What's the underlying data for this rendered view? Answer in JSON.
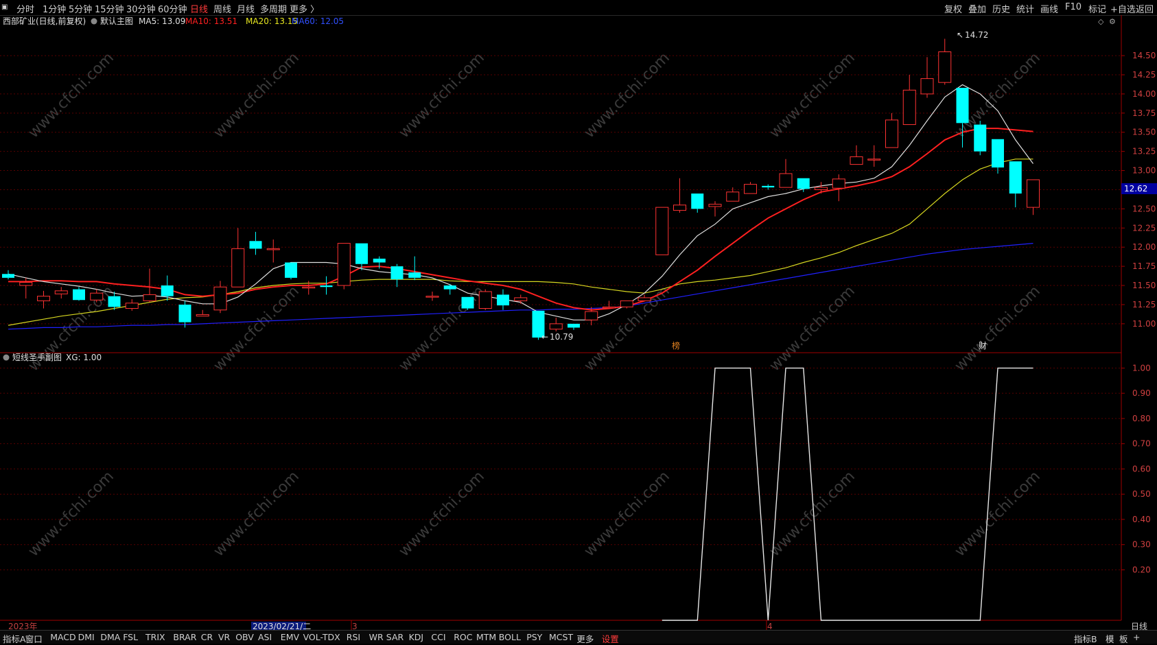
{
  "topbar": {
    "periods": [
      "分时",
      "1分钟",
      "5分钟",
      "15分钟",
      "30分钟",
      "60分钟",
      "日线",
      "周线",
      "月线",
      "多周期",
      "更多 〉"
    ],
    "active_period": "日线",
    "right_buttons": [
      "复权",
      "叠加",
      "历史",
      "统计",
      "画线",
      "F10",
      "标记",
      "+自选",
      "返回"
    ]
  },
  "main_chart": {
    "stock_name": "西部矿业(日线,前复权)",
    "indicator_name": "默认主图",
    "ma5_label": "MA5: 13.09",
    "ma10_label": "MA10: 13.51",
    "ma20_label": "MA20: 13.15",
    "ma60_label": "MA60: 12.05",
    "high_marker": "14.72",
    "low_marker": "10.79",
    "current_price": "12.62",
    "event_labels": [
      "榜",
      "财"
    ],
    "colors": {
      "up": "#ff3333",
      "down": "#00ffff",
      "ma5": "#e0e0e0",
      "ma10": "#ff2020",
      "ma20": "#d8d820",
      "ma60": "#2020ff",
      "grid": "#5a0000"
    }
  },
  "sub_chart": {
    "title": "短线圣手副图",
    "xg_label": "XG: 1.00"
  },
  "x_axis": {
    "labels": [
      "2023年",
      "2023/02/21/二",
      "3",
      "4"
    ]
  },
  "right_panel_label": "日线",
  "bottom_tabs": [
    "指标A",
    "窗口",
    "MACD",
    "DMI",
    "DMA",
    "FSL",
    "TRIX",
    "BRAR",
    "CR",
    "VR",
    "OBV",
    "ASI",
    "EMV",
    "VOL-TDX",
    "RSI",
    "WR",
    "SAR",
    "KDJ",
    "CCI",
    "ROC",
    "MTM",
    "BOLL",
    "PSY",
    "MCST",
    "更多",
    "设置"
  ],
  "bottom_right": [
    "指标B",
    "模",
    "板",
    "+"
  ],
  "watermark": "www.cfchi.com",
  "chart_data": [
    {
      "type": "candlestick",
      "title": "西部矿业(日线,前复权)",
      "ylim": [
        10.73,
        14.85
      ],
      "yticks": [
        11.0,
        11.25,
        11.5,
        11.75,
        12.0,
        12.25,
        12.5,
        12.75,
        13.0,
        13.25,
        13.5,
        13.75,
        14.0,
        14.25,
        14.5
      ],
      "candles": [
        [
          11.65,
          11.6,
          11.7,
          11.58
        ],
        [
          11.5,
          11.54,
          11.6,
          11.33
        ],
        [
          11.3,
          11.36,
          11.43,
          11.2
        ],
        [
          11.39,
          11.43,
          11.48,
          11.33
        ],
        [
          11.45,
          11.31,
          11.48,
          11.3
        ],
        [
          11.31,
          11.4,
          11.45,
          11.28
        ],
        [
          11.36,
          11.22,
          11.42,
          11.18
        ],
        [
          11.2,
          11.27,
          11.32,
          11.17
        ],
        [
          11.3,
          11.38,
          11.72,
          11.28
        ],
        [
          11.5,
          11.36,
          11.63,
          11.3
        ],
        [
          11.25,
          11.02,
          11.3,
          10.95
        ],
        [
          11.1,
          11.12,
          11.18,
          11.1
        ],
        [
          11.18,
          11.48,
          11.56,
          11.14
        ],
        [
          11.48,
          11.98,
          12.25,
          11.48
        ],
        [
          12.08,
          11.98,
          12.2,
          11.9
        ],
        [
          11.98,
          11.98,
          12.1,
          11.8
        ],
        [
          11.8,
          11.6,
          11.8,
          11.58
        ],
        [
          11.48,
          11.48,
          11.56,
          11.38
        ],
        [
          11.5,
          11.48,
          11.62,
          11.38
        ],
        [
          11.5,
          12.05,
          12.05,
          11.45
        ],
        [
          12.05,
          11.78,
          12.05,
          11.7
        ],
        [
          11.85,
          11.8,
          11.88,
          11.72
        ],
        [
          11.75,
          11.58,
          11.78,
          11.48
        ],
        [
          11.67,
          11.6,
          11.88,
          11.57
        ],
        [
          11.35,
          11.36,
          11.42,
          11.3
        ],
        [
          11.5,
          11.45,
          11.52,
          11.38
        ],
        [
          11.35,
          11.2,
          11.35,
          11.18
        ],
        [
          11.2,
          11.42,
          11.45,
          11.18
        ],
        [
          11.38,
          11.24,
          11.45,
          11.18
        ],
        [
          11.3,
          11.34,
          11.38,
          11.26
        ],
        [
          11.17,
          10.82,
          11.17,
          10.79
        ],
        [
          10.93,
          11.0,
          11.08,
          10.9
        ],
        [
          11.0,
          10.95,
          11.0,
          10.92
        ],
        [
          11.05,
          11.16,
          11.22,
          10.98
        ],
        [
          11.22,
          11.22,
          11.3,
          11.2
        ],
        [
          11.22,
          11.3,
          11.3,
          11.2
        ],
        [
          11.3,
          11.34,
          11.38,
          11.3
        ],
        [
          11.9,
          12.52,
          12.52,
          11.9
        ],
        [
          12.48,
          12.55,
          12.9,
          12.45
        ],
        [
          12.7,
          12.5,
          12.7,
          12.45
        ],
        [
          12.53,
          12.56,
          12.6,
          12.4
        ],
        [
          12.6,
          12.72,
          12.78,
          12.6
        ],
        [
          12.7,
          12.82,
          12.85,
          12.72
        ],
        [
          12.8,
          12.78,
          12.82,
          12.75
        ],
        [
          12.78,
          12.96,
          13.15,
          12.78
        ],
        [
          12.9,
          12.76,
          12.9,
          12.72
        ],
        [
          12.75,
          12.78,
          12.85,
          12.7
        ],
        [
          12.77,
          12.89,
          12.95,
          12.6
        ],
        [
          13.08,
          13.18,
          13.33,
          13.08
        ],
        [
          13.15,
          13.15,
          13.33,
          13.05
        ],
        [
          13.3,
          13.66,
          13.75,
          13.3
        ],
        [
          13.6,
          14.05,
          14.25,
          13.6
        ],
        [
          14.0,
          14.2,
          14.48,
          13.95
        ],
        [
          14.15,
          14.55,
          14.72,
          14.12
        ],
        [
          14.08,
          13.62,
          14.08,
          13.3
        ],
        [
          13.6,
          13.25,
          13.65,
          13.2
        ],
        [
          13.41,
          13.04,
          13.41,
          12.96
        ],
        [
          13.12,
          12.7,
          13.12,
          12.52
        ],
        [
          12.52,
          12.88,
          12.88,
          12.42
        ]
      ],
      "ma5": [
        11.65,
        11.6,
        11.55,
        11.52,
        11.49,
        11.45,
        11.4,
        11.36,
        11.37,
        11.35,
        11.3,
        11.26,
        11.26,
        11.35,
        11.52,
        11.72,
        11.8,
        11.8,
        11.8,
        11.78,
        11.72,
        11.68,
        11.66,
        11.64,
        11.6,
        11.51,
        11.4,
        11.36,
        11.32,
        11.28,
        11.15,
        11.1,
        11.05,
        11.05,
        11.13,
        11.25,
        11.4,
        11.62,
        11.9,
        12.15,
        12.3,
        12.5,
        12.58,
        12.66,
        12.7,
        12.76,
        12.8,
        12.83,
        12.85,
        12.9,
        13.05,
        13.33,
        13.65,
        13.96,
        14.12,
        14.0,
        13.78,
        13.4,
        13.09
      ],
      "ma10": [
        11.55,
        11.55,
        11.56,
        11.56,
        11.55,
        11.55,
        11.52,
        11.5,
        11.48,
        11.45,
        11.38,
        11.36,
        11.38,
        11.4,
        11.45,
        11.48,
        11.5,
        11.5,
        11.52,
        11.62,
        11.74,
        11.75,
        11.72,
        11.68,
        11.64,
        11.6,
        11.56,
        11.53,
        11.5,
        11.45,
        11.36,
        11.27,
        11.21,
        11.18,
        11.2,
        11.23,
        11.3,
        11.4,
        11.55,
        11.7,
        11.88,
        12.05,
        12.22,
        12.38,
        12.5,
        12.62,
        12.72,
        12.76,
        12.8,
        12.85,
        12.92,
        13.05,
        13.22,
        13.4,
        13.5,
        13.55,
        13.55,
        13.53,
        13.51
      ],
      "ma20": [
        10.98,
        11.02,
        11.06,
        11.1,
        11.13,
        11.16,
        11.2,
        11.24,
        11.28,
        11.32,
        11.34,
        11.35,
        11.38,
        11.42,
        11.47,
        11.5,
        11.52,
        11.53,
        11.53,
        11.55,
        11.57,
        11.58,
        11.58,
        11.58,
        11.58,
        11.56,
        11.55,
        11.55,
        11.55,
        11.55,
        11.55,
        11.54,
        11.52,
        11.48,
        11.45,
        11.42,
        11.4,
        11.45,
        11.52,
        11.55,
        11.57,
        11.6,
        11.63,
        11.68,
        11.73,
        11.8,
        11.86,
        11.93,
        12.02,
        12.1,
        12.18,
        12.3,
        12.5,
        12.7,
        12.88,
        13.02,
        13.1,
        13.15,
        13.15
      ],
      "ma60": [
        10.93,
        10.94,
        10.95,
        10.95,
        10.96,
        10.96,
        10.97,
        10.98,
        10.98,
        10.99,
        10.99,
        11.0,
        11.01,
        11.02,
        11.03,
        11.04,
        11.05,
        11.06,
        11.07,
        11.08,
        11.09,
        11.1,
        11.11,
        11.12,
        11.13,
        11.14,
        11.15,
        11.16,
        11.17,
        11.18,
        11.18,
        11.19,
        11.19,
        11.2,
        11.21,
        11.23,
        11.27,
        11.31,
        11.35,
        11.39,
        11.43,
        11.47,
        11.51,
        11.55,
        11.59,
        11.63,
        11.67,
        11.71,
        11.75,
        11.79,
        11.83,
        11.87,
        11.91,
        11.94,
        11.97,
        11.99,
        12.01,
        12.03,
        12.05
      ]
    },
    {
      "type": "line",
      "title": "短线圣手副图",
      "ylim": [
        0.0,
        1.05
      ],
      "yticks": [
        0.2,
        0.3,
        0.4,
        0.5,
        0.6,
        0.7,
        0.8,
        0.9,
        1.0
      ],
      "series": [
        {
          "name": "XG",
          "start_index": 37,
          "values": [
            0,
            0,
            0,
            1,
            1,
            1,
            0,
            1,
            1,
            0,
            0,
            0,
            0,
            0,
            0,
            0,
            0,
            0,
            0,
            1,
            1,
            1
          ]
        }
      ]
    }
  ]
}
